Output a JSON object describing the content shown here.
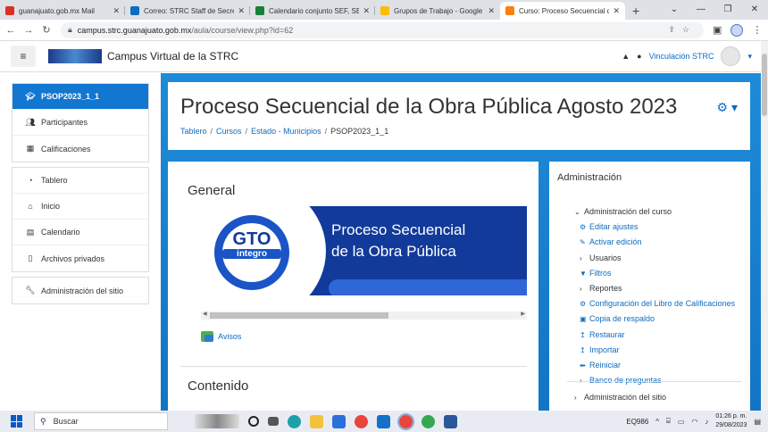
{
  "browser": {
    "tabs": [
      {
        "title": "guanajuato.gob.mx Mail",
        "color": "#d93025"
      },
      {
        "title": "Correo: STRC Staff de Secreta",
        "color": "#0f6cbf"
      },
      {
        "title": "Calendario conjunto SEF, SEA",
        "color": "#188038"
      },
      {
        "title": "Grupos de Trabajo - Google",
        "color": "#fbbc04"
      },
      {
        "title": "Curso: Proceso Secuencial de",
        "color": "#f98012",
        "active": true
      }
    ],
    "new_tab": "+",
    "url_host": "campus.strc.guanajuato.gob.mx",
    "url_path": "/aula/course/view.php?id=62"
  },
  "navbar": {
    "site_name": "Campus Virtual de la STRC",
    "user_name": "Vinculación STRC",
    "bell": "▲",
    "chat": "●"
  },
  "sidebar": {
    "course": "PSOP2023_1_1",
    "items": [
      {
        "label": "Participantes",
        "icon": "users-icon"
      },
      {
        "label": "Calificaciones",
        "icon": "table-icon"
      },
      {
        "label": "Tablero",
        "icon": "dashboard-icon"
      },
      {
        "label": "Inicio",
        "icon": "home-icon"
      },
      {
        "label": "Calendario",
        "icon": "calendar-icon"
      },
      {
        "label": "Archivos privados",
        "icon": "file-icon"
      },
      {
        "label": "Administración del sitio",
        "icon": "wrench-icon"
      }
    ]
  },
  "header": {
    "title": "Proceso Secuencial de la Obra Pública Agosto 2023",
    "breadcrumb": [
      "Tablero",
      "Cursos",
      "Estado - Municipios",
      "PSOP2023_1_1"
    ]
  },
  "main": {
    "general_title": "General",
    "banner": {
      "logo_top": "GTO",
      "logo_bottom": "integro",
      "line1": "Proceso Secuencial",
      "line2": "de la Obra Pública"
    },
    "avisos": "Avisos",
    "contenido_title": "Contenido"
  },
  "admin": {
    "title": "Administración",
    "course_admin": "Administración del curso",
    "items": [
      {
        "label": "Editar ajustes",
        "type": "link",
        "icon": "gear-icon"
      },
      {
        "label": "Activar edición",
        "type": "link",
        "icon": "pencil-icon"
      },
      {
        "label": "Usuarios",
        "type": "folder"
      },
      {
        "label": "Filtros",
        "type": "link",
        "icon": "filter-icon"
      },
      {
        "label": "Reportes",
        "type": "folder"
      },
      {
        "label": "Configuración del Libro de Calificaciones",
        "type": "link",
        "icon": "gear-icon"
      },
      {
        "label": "Copia de respaldo",
        "type": "link",
        "icon": "backup-icon"
      },
      {
        "label": "Restaurar",
        "type": "link",
        "icon": "upload-icon"
      },
      {
        "label": "Importar",
        "type": "link",
        "icon": "import-icon"
      },
      {
        "label": "Reiniciar",
        "type": "link",
        "icon": "reset-icon"
      },
      {
        "label": "Banco de preguntas",
        "type": "folder-link"
      }
    ],
    "site_admin": "Administración del sitio"
  },
  "taskbar": {
    "search_placeholder": "Buscar",
    "tray_label": "EQ986",
    "time": "01:26 p. m.",
    "date": "29/08/2023"
  }
}
